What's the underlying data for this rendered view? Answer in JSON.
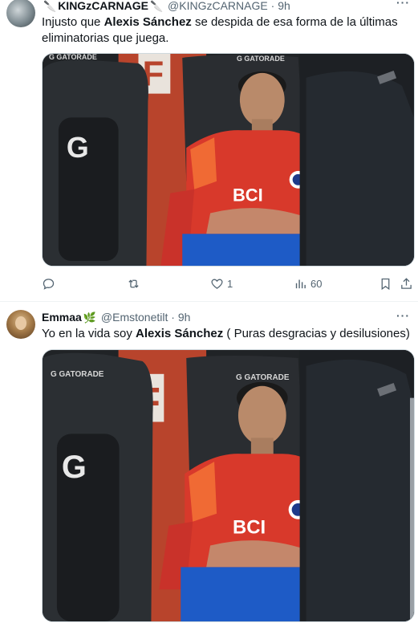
{
  "tweets": [
    {
      "display_name": "KINGzCARNAGE",
      "name_emoji_left": "🔪",
      "name_emoji_right": "🔪",
      "handle": "@KINGzCARNAGE",
      "dot": "·",
      "time": "9h",
      "text_pre": "Injusto que ",
      "text_bold": "Alexis Sánchez",
      "text_post": " se despida de esa forma de la últimas eliminatorias que juega.",
      "media": {
        "brand": "G GATORADE",
        "brand_right": "G GATORADE",
        "sponsor": "BCI",
        "logo": "F"
      },
      "metrics": {
        "replies": "",
        "reposts": "",
        "likes": "1",
        "views": "60"
      }
    },
    {
      "display_name": "Emmaa",
      "name_emoji": "🌿",
      "handle": "@Emstonetilt",
      "dot": "·",
      "time": "9h",
      "text_pre": "Yo en la vida soy ",
      "text_bold": "Alexis Sánchez",
      "text_post": " ( Puras desgracias y desilusiones)",
      "media": {
        "brand": "G GATORADE",
        "brand_right": "G GATORADE",
        "sponsor": "BCI",
        "logo": "F"
      }
    }
  ],
  "more_label": "···",
  "icons": [
    "reply-icon",
    "repost-icon",
    "like-icon",
    "views-icon",
    "bookmark-icon",
    "share-icon",
    "more-icon"
  ],
  "colors": {
    "text": "#0f1419",
    "secondary": "#536471",
    "border": "#cfd9de",
    "jersey_red": "#d8392b",
    "shorts_blue": "#1e5bc6"
  }
}
